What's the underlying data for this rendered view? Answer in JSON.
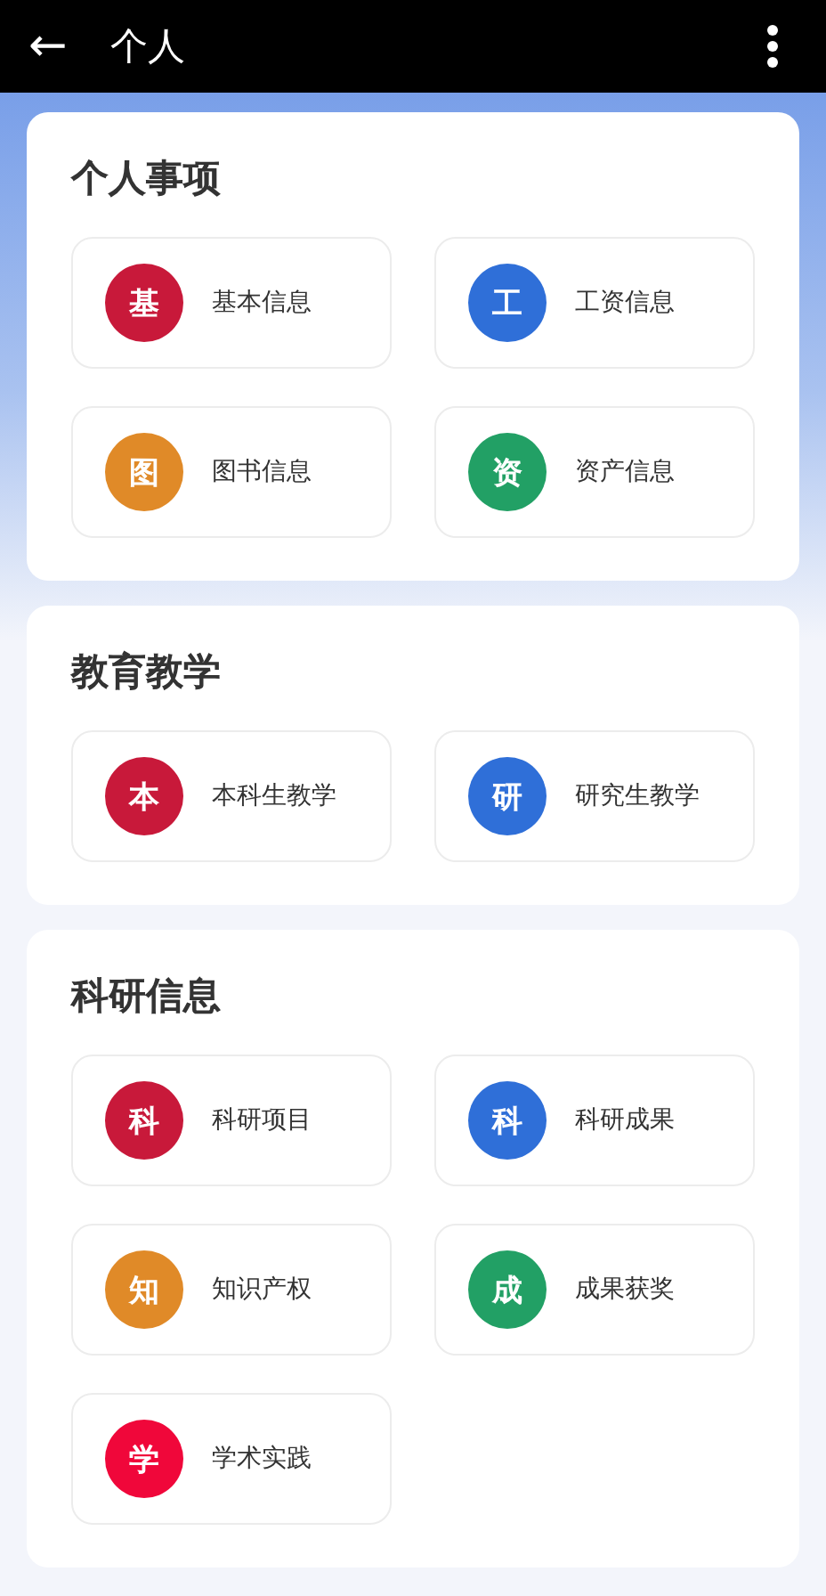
{
  "app_bar": {
    "back_icon": "←",
    "title": "个人"
  },
  "sections": [
    {
      "title": "个人事项",
      "items": [
        {
          "badge": "基",
          "label": "基本信息",
          "color": "#c8193a"
        },
        {
          "badge": "工",
          "label": "工资信息",
          "color": "#2f6fd8"
        },
        {
          "badge": "图",
          "label": "图书信息",
          "color": "#e08a28"
        },
        {
          "badge": "资",
          "label": "资产信息",
          "color": "#22a065"
        }
      ]
    },
    {
      "title": "教育教学",
      "items": [
        {
          "badge": "本",
          "label": "本科生教学",
          "color": "#c8193a"
        },
        {
          "badge": "研",
          "label": "研究生教学",
          "color": "#2f6fd8"
        }
      ]
    },
    {
      "title": "科研信息",
      "items": [
        {
          "badge": "科",
          "label": "科研项目",
          "color": "#c8193a"
        },
        {
          "badge": "科",
          "label": "科研成果",
          "color": "#2f6fd8"
        },
        {
          "badge": "知",
          "label": "知识产权",
          "color": "#e08a28"
        },
        {
          "badge": "成",
          "label": "成果获奖",
          "color": "#22a065"
        },
        {
          "badge": "学",
          "label": "学术实践",
          "color": "#f0073a"
        }
      ]
    }
  ]
}
